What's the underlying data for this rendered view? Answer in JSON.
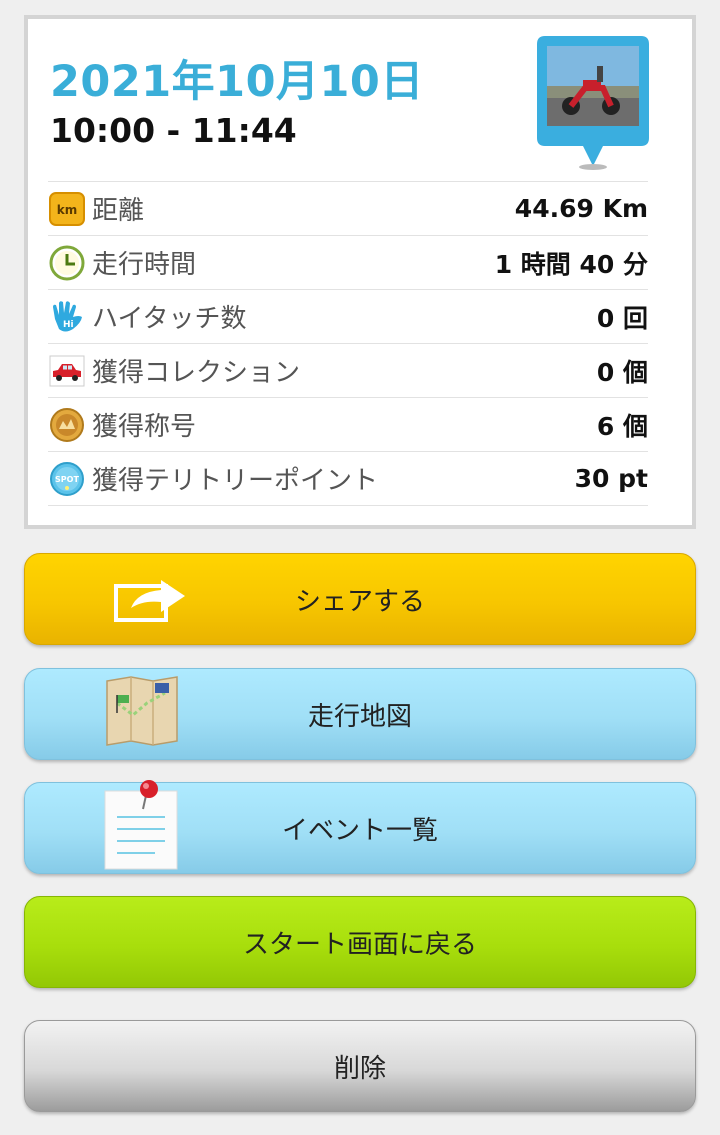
{
  "header": {
    "date": "2021年10月10日",
    "time_range": "10:00 - 11:44"
  },
  "photo": {
    "icon": "motorcycle-photo-pin"
  },
  "stats": [
    {
      "icon": "km-badge-icon",
      "icon_text": "km",
      "label": "距離",
      "value": "44.69 Km"
    },
    {
      "icon": "clock-icon",
      "label": "走行時間",
      "value": "1 時間 40 分"
    },
    {
      "icon": "high-five-hand-icon",
      "icon_text": "Hi",
      "label": "ハイタッチ数",
      "value": "0 回"
    },
    {
      "icon": "car-icon",
      "label": "獲得コレクション",
      "value": "0 個"
    },
    {
      "icon": "medal-icon",
      "label": "獲得称号",
      "value": "6 個"
    },
    {
      "icon": "spot-icon",
      "icon_text": "SPOT",
      "label": "獲得テリトリーポイント",
      "value": "30 pt"
    }
  ],
  "buttons": {
    "share": "シェアする",
    "map": "走行地図",
    "events": "イベント一覧",
    "back_to_start": "スタート画面に戻る",
    "delete": "削除"
  },
  "colors": {
    "date": "#3aaed8",
    "share_button": "#f7c600",
    "map_button": "#a0dff6",
    "start_button": "#a8de0c",
    "delete_button": "#d8d8d8"
  }
}
